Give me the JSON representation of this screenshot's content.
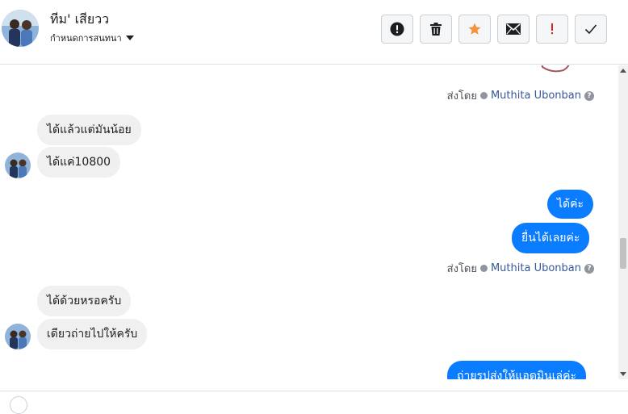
{
  "header": {
    "contact_name": "ทีม' เสียวว",
    "subtitle": "กำหนดการสนทนา"
  },
  "toolbar": [
    {
      "name": "report-button",
      "icon": "exclamation-circle-icon"
    },
    {
      "name": "delete-button",
      "icon": "trash-icon"
    },
    {
      "name": "star-button",
      "icon": "star-icon",
      "color": "#f7923b"
    },
    {
      "name": "mail-button",
      "icon": "envelope-icon"
    },
    {
      "name": "important-button",
      "icon": "exclamation-icon",
      "color": "#e02020"
    },
    {
      "name": "done-button",
      "icon": "checkmark-icon"
    }
  ],
  "messages": {
    "sent_by_label": "ส่งโดย",
    "sender_name": "Muthita Ubonban",
    "in1": "ได้แล้วแต่มันน้อย",
    "in2": "ได้แค่10800",
    "out1": "ได้ค่ะ",
    "out2": "ยื่นได้เลยค่ะ",
    "in3": "ได้ด้วยหรอครับ",
    "in4": "เดียวถ่ายไปให้ครับ",
    "out3": "ถ่ายรูปส่งให้แอดมินเล่ค่ะ"
  },
  "colors": {
    "outgoing_bubble": "#0a7cff",
    "incoming_bubble": "#f0f0f0",
    "accent_link": "#385898"
  }
}
